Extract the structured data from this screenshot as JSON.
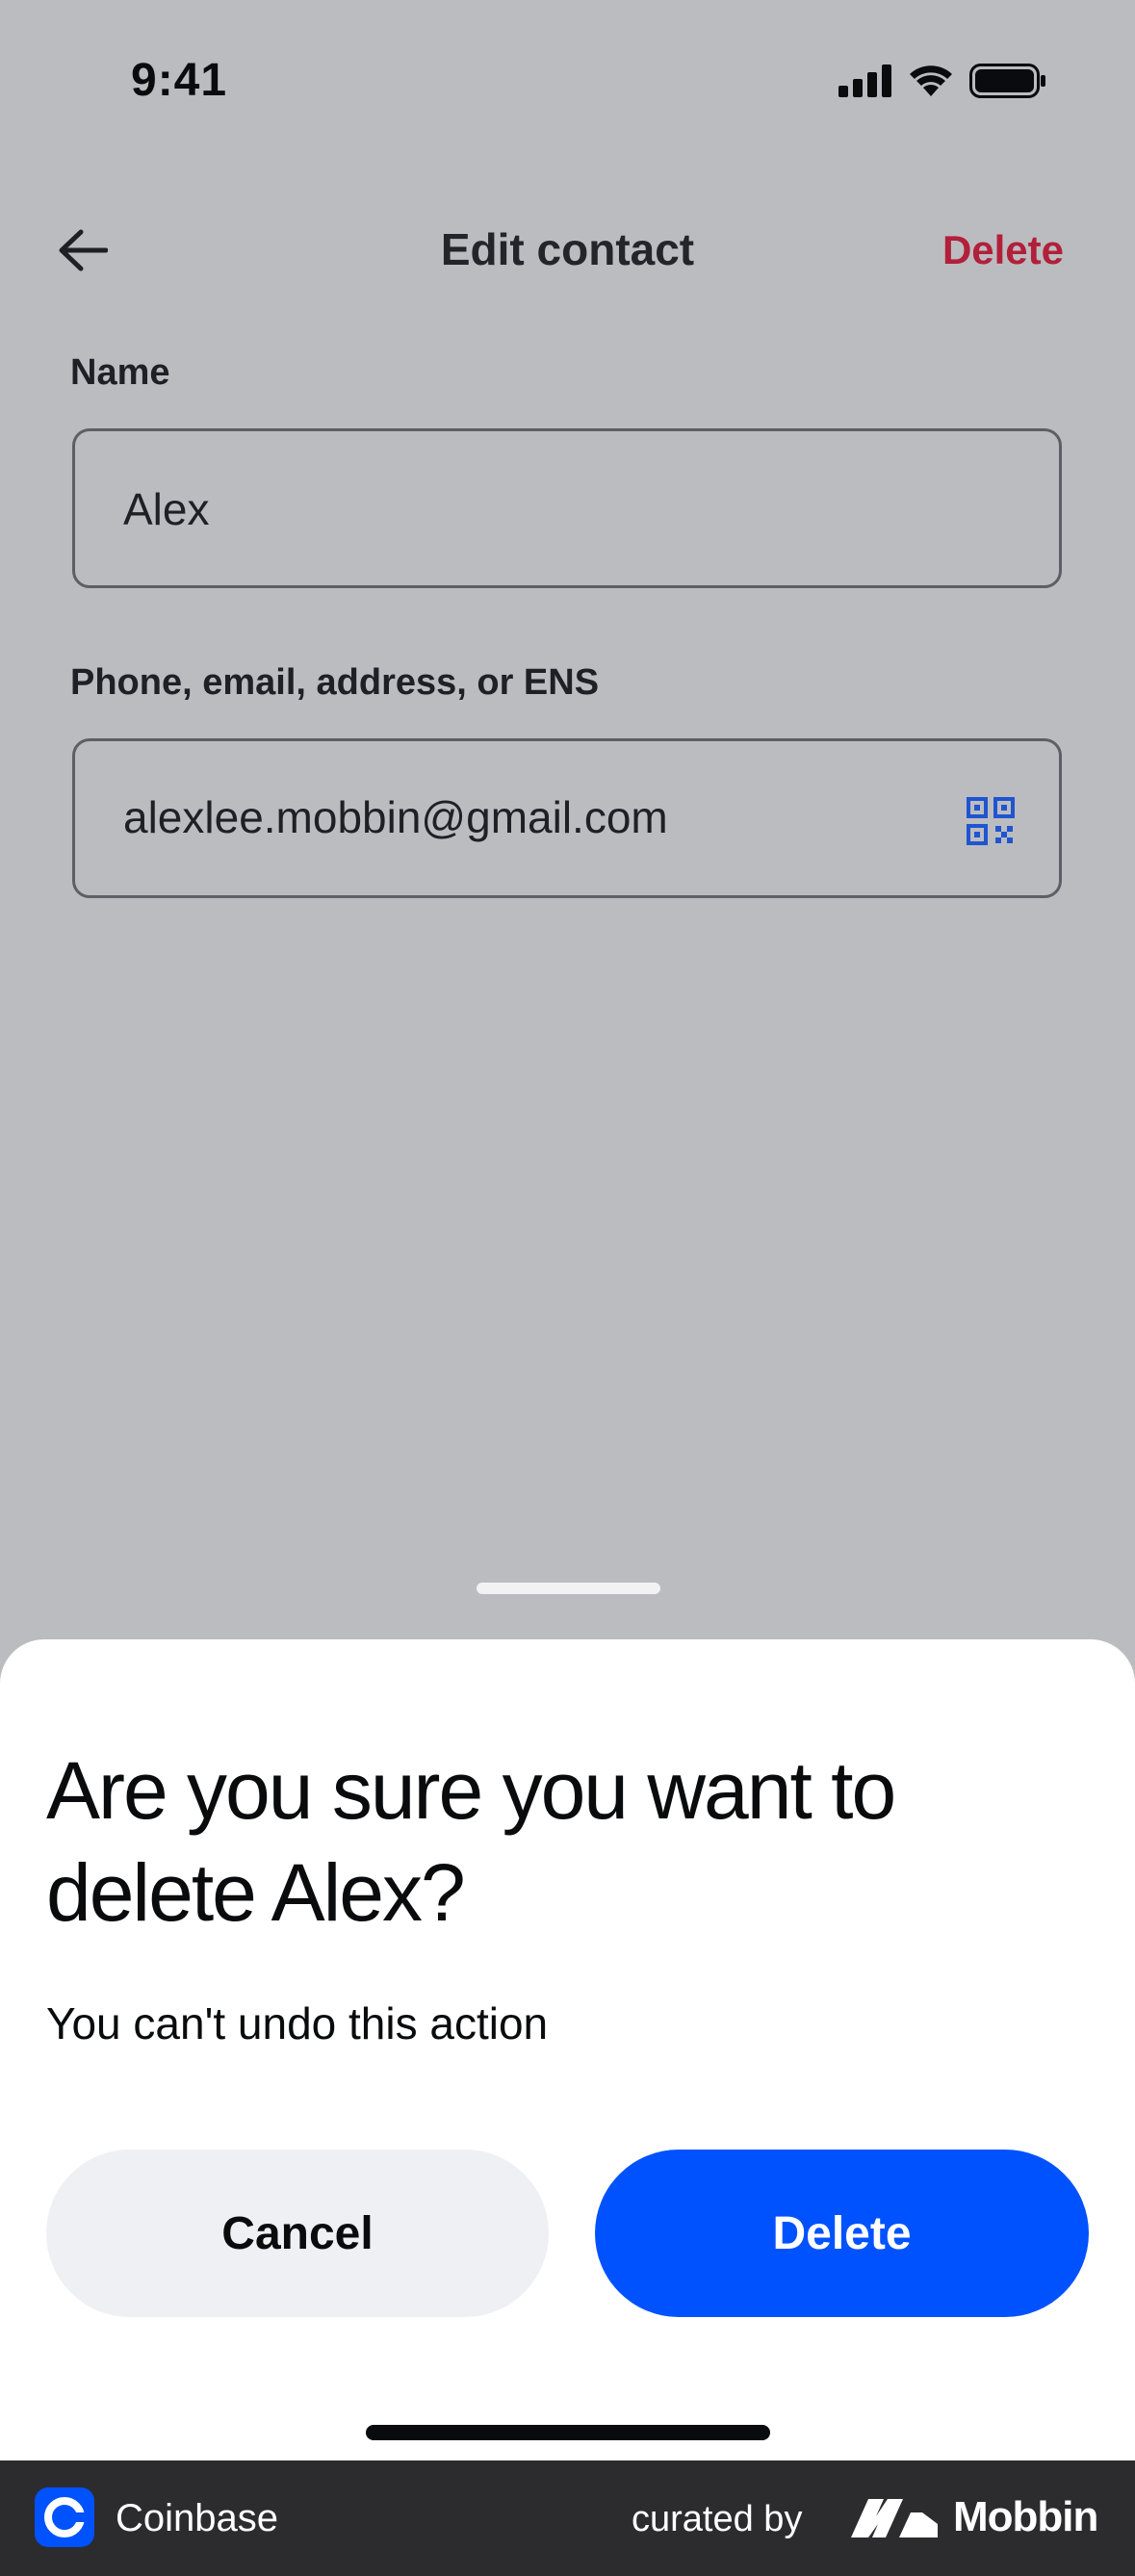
{
  "status_bar": {
    "time": "9:41"
  },
  "nav": {
    "title": "Edit contact",
    "delete_label": "Delete"
  },
  "form": {
    "name_label": "Name",
    "name_value": "Alex",
    "address_label": "Phone, email, address, or ENS",
    "address_value": "alexlee.mobbin@gmail.com"
  },
  "sheet": {
    "title": "Are you sure you want to delete Alex?",
    "subtitle": "You can't undo this action",
    "cancel_label": "Cancel",
    "delete_label": "Delete"
  },
  "footer": {
    "brand": "Coinbase",
    "curated_by": "curated by",
    "curator": "Mobbin"
  },
  "colors": {
    "accent": "#0052ff",
    "destructive": "#b21f3a",
    "scrim": "#bbbcc0"
  },
  "icons": [
    "signal-icon",
    "wifi-icon",
    "battery-icon",
    "back-arrow-icon",
    "qr-code-icon",
    "coinbase-logo",
    "mobbin-logo"
  ]
}
